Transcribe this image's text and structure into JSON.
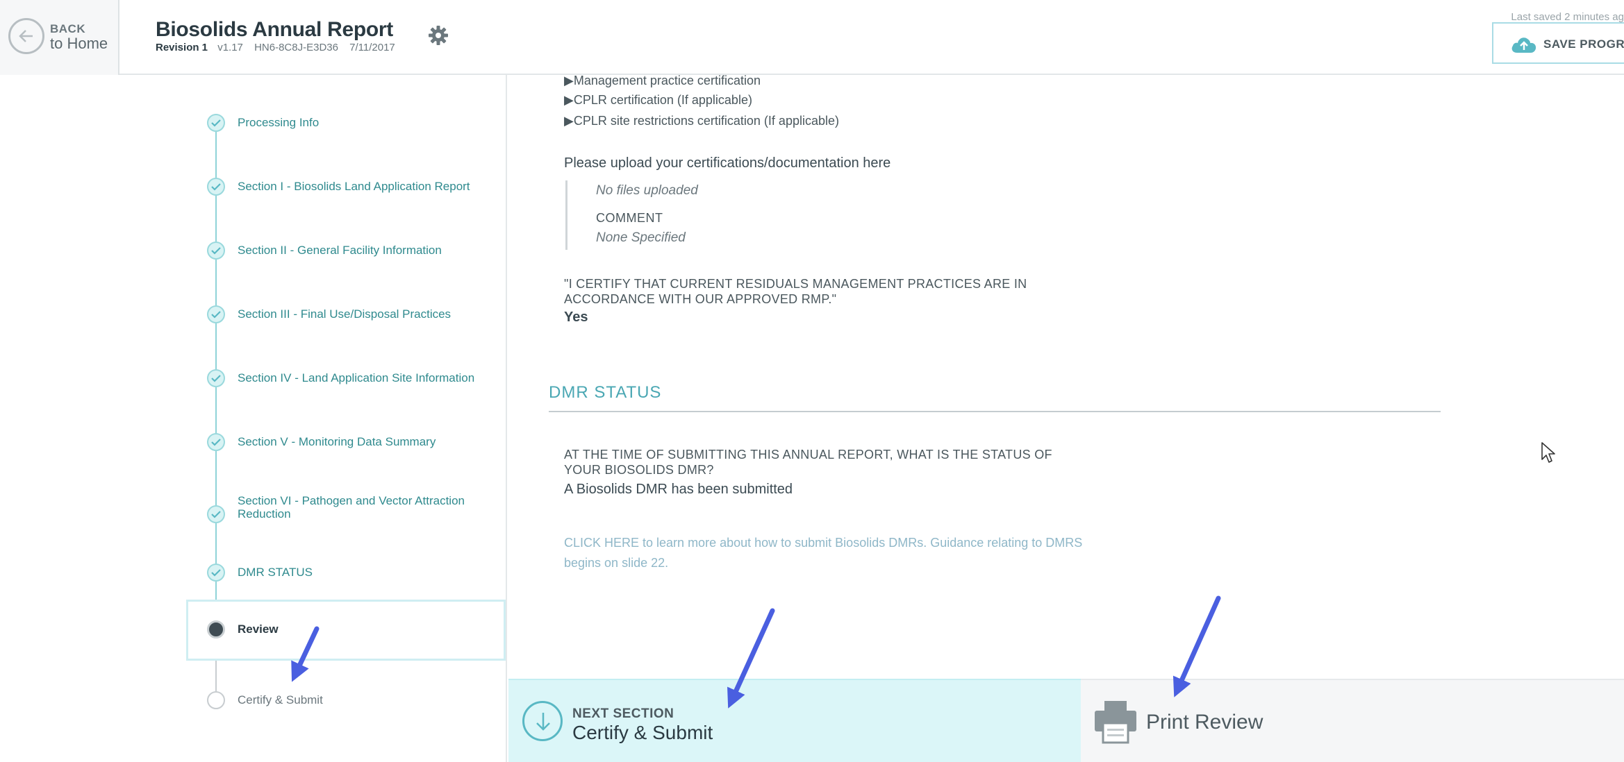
{
  "header": {
    "back_small": "BACK",
    "back_large": "to Home",
    "title": "Biosolids Annual Report",
    "revision": "Revision 1",
    "version": "v1.17",
    "code": "HN6-8C8J-E3D36",
    "date": "7/11/2017",
    "last_saved": "Last saved 2 minutes ag",
    "save_label": "SAVE PROGRESS"
  },
  "sidebar": {
    "steps": [
      {
        "label": "Processing Info",
        "state": "complete"
      },
      {
        "label": "Section I - Biosolids Land Application Report",
        "state": "complete"
      },
      {
        "label": "Section II - General Facility Information",
        "state": "complete"
      },
      {
        "label": "Section III - Final Use/Disposal Practices",
        "state": "complete"
      },
      {
        "label": "Section IV - Land Application Site Information",
        "state": "complete"
      },
      {
        "label": "Section V - Monitoring Data Summary",
        "state": "complete"
      },
      {
        "label": "Section VI - Pathogen and Vector Attraction Reduction",
        "state": "complete"
      },
      {
        "label": "DMR STATUS",
        "state": "complete"
      },
      {
        "label": "Review",
        "state": "current"
      },
      {
        "label": "Certify & Submit",
        "state": "future"
      }
    ]
  },
  "main": {
    "cert_items": [
      "▶Management practice certification",
      "▶CPLR certification (If applicable)",
      "▶CPLR site restrictions certification (If applicable)"
    ],
    "upload_title": "Please upload your certifications/documentation here",
    "no_files": "No files uploaded",
    "comment_label": "COMMENT",
    "comment_value": "None Specified",
    "certify_question": "\"I CERTIFY THAT CURRENT RESIDUALS MANAGEMENT PRACTICES ARE IN ACCORDANCE WITH OUR APPROVED RMP.\"",
    "certify_answer": "Yes",
    "dmr_heading": "DMR STATUS",
    "dmr_question": "AT THE TIME OF SUBMITTING THIS ANNUAL REPORT, WHAT IS THE STATUS OF YOUR BIOSOLIDS DMR?",
    "dmr_answer": "A Biosolids DMR has been submitted",
    "dmr_link": "CLICK HERE to learn more about how to submit Biosolids DMRs. Guidance relating to DMRS begins on slide 22."
  },
  "footer": {
    "next_small": "NEXT SECTION",
    "next_large": "Certify & Submit",
    "print_label": "Print Review"
  },
  "colors": {
    "accent_teal": "#4aa7b3",
    "next_bg": "#dbf6f8",
    "annotation_arrow": "#4a5fe0"
  }
}
